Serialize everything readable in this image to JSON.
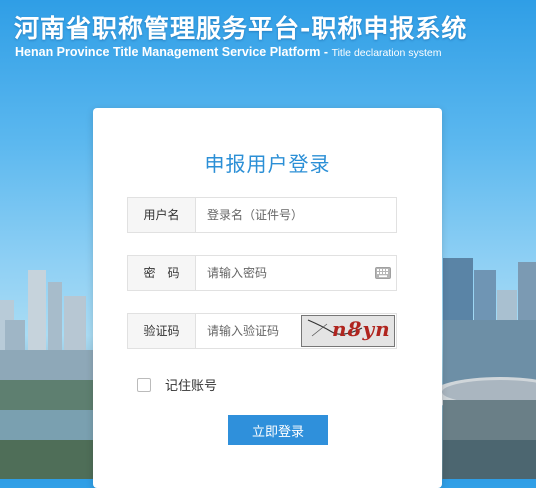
{
  "header": {
    "title_cn": "河南省职称管理服务平台",
    "title_cn_sub": "职称申报系统",
    "title_en": "Henan Province Title Management Service Platform",
    "title_en_sub": "Title declaration system",
    "separator": "-"
  },
  "login": {
    "title": "申报用户登录",
    "username": {
      "label": "用户名",
      "placeholder": "登录名（证件号）",
      "value": ""
    },
    "password": {
      "label": "密　码",
      "placeholder": "请输入密码",
      "value": "",
      "icon": "keyboard-icon"
    },
    "captcha": {
      "label": "验证码",
      "placeholder": "请输入验证码",
      "value": "",
      "image_text": "n8yn"
    },
    "remember": {
      "label": "记住账号",
      "checked": false
    },
    "submit_label": "立即登录"
  },
  "colors": {
    "accent": "#2f90db",
    "title_blue": "#2b8fd6",
    "captcha_red": "#b0251f"
  }
}
